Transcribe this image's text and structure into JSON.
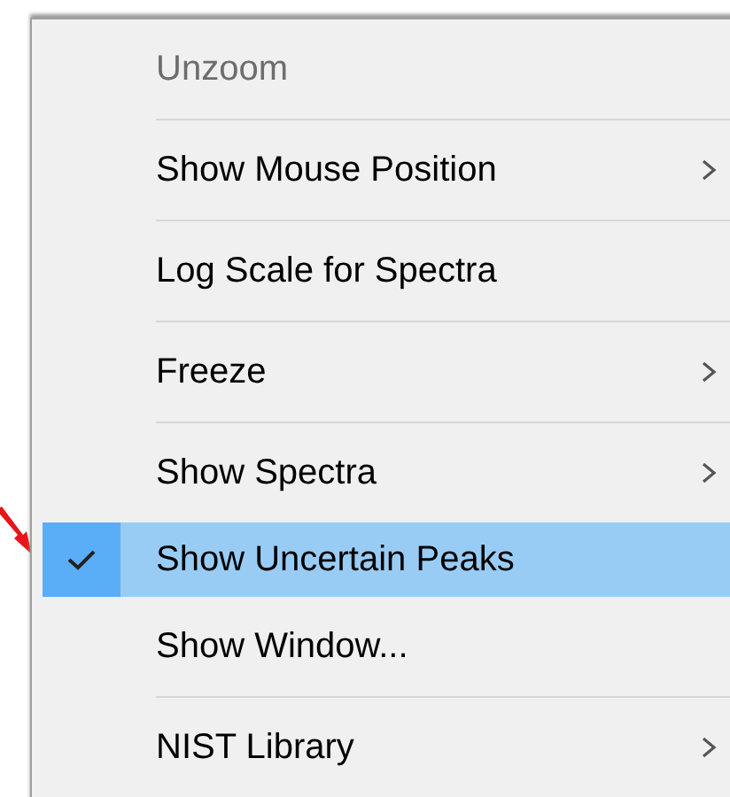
{
  "menu": {
    "items": [
      {
        "label": "Unzoom",
        "disabled": true,
        "submenu": false,
        "checked": false,
        "selected": false
      },
      {
        "label": "Show Mouse Position",
        "disabled": false,
        "submenu": true,
        "checked": false,
        "selected": false
      },
      {
        "label": "Log Scale for Spectra",
        "disabled": false,
        "submenu": false,
        "checked": false,
        "selected": false
      },
      {
        "label": "Freeze",
        "disabled": false,
        "submenu": true,
        "checked": false,
        "selected": false
      },
      {
        "label": "Show Spectra",
        "disabled": false,
        "submenu": true,
        "checked": false,
        "selected": false
      },
      {
        "label": "Show Uncertain Peaks",
        "disabled": false,
        "submenu": false,
        "checked": true,
        "selected": true
      },
      {
        "label": "Show Window...",
        "disabled": false,
        "submenu": false,
        "checked": false,
        "selected": false
      },
      {
        "label": "NIST Library",
        "disabled": false,
        "submenu": true,
        "checked": false,
        "selected": false
      }
    ]
  }
}
